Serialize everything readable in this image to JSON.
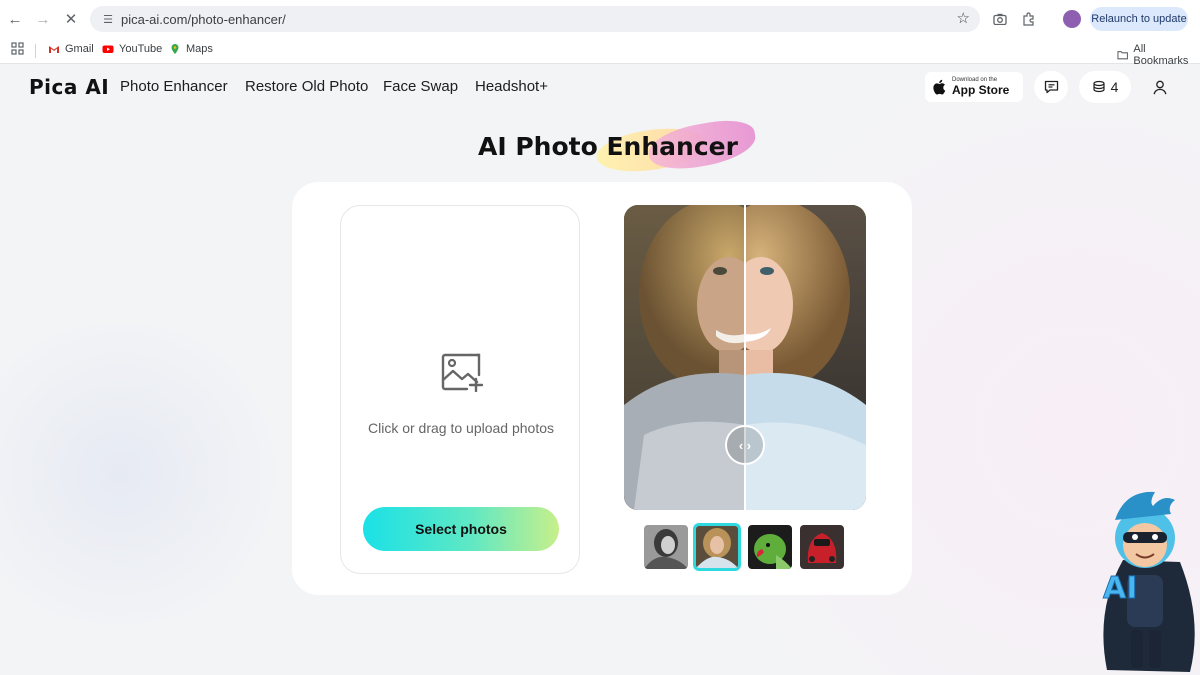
{
  "browser": {
    "url": "pica-ai.com/photo-enhancer/",
    "relaunch_label": "Relaunch to update",
    "bookmarks": [
      {
        "label": "Gmail"
      },
      {
        "label": "YouTube"
      },
      {
        "label": "Maps"
      }
    ],
    "all_bookmarks_label": "All Bookmarks"
  },
  "header": {
    "logo": "Pica AI",
    "nav": [
      "Photo Enhancer",
      "Restore Old Photo",
      "Face Swap",
      "Headshot+"
    ],
    "appstore_small": "Download on the",
    "appstore_big": "App Store",
    "credits": "4"
  },
  "main": {
    "title": "AI Photo Enhancer",
    "upload_hint": "Click or drag to upload photos",
    "select_button": "Select photos",
    "sample_count": 4,
    "active_sample": 2
  },
  "colors": {
    "button_gradient_start": "#1ae1e6",
    "button_gradient_end": "#c7ef8a",
    "active_thumb_border": "#2fd9e0"
  }
}
